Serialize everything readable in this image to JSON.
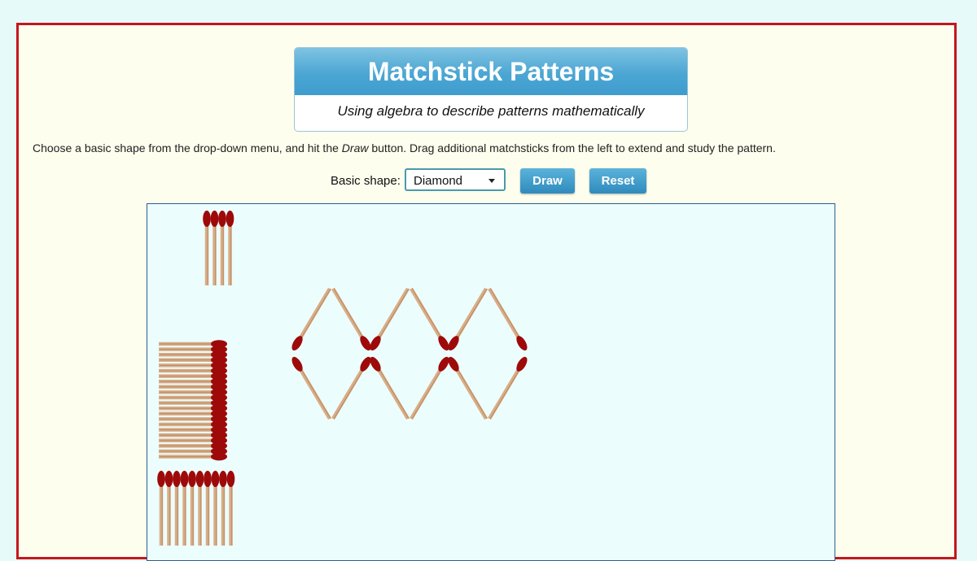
{
  "header": {
    "title": "Matchstick Patterns",
    "subtitle": "Using algebra to describe patterns mathematically"
  },
  "instructions": {
    "part1": "Choose a basic shape from the drop-down menu, and hit the ",
    "emphasis": "Draw",
    "part2": " button. Drag additional matchsticks from the left to extend and study the pattern."
  },
  "controls": {
    "shape_label": "Basic shape:",
    "shape_selected": "Diamond",
    "draw_label": "Draw",
    "reset_label": "Reset"
  },
  "pattern": {
    "shape": "Diamond",
    "diamond_count": 3,
    "matchstick_count": 12
  },
  "colors": {
    "frame_border": "#c4161c",
    "match_head": "#9e0a0a",
    "match_stick": "#d9ad86",
    "button": "#3a97c9"
  }
}
